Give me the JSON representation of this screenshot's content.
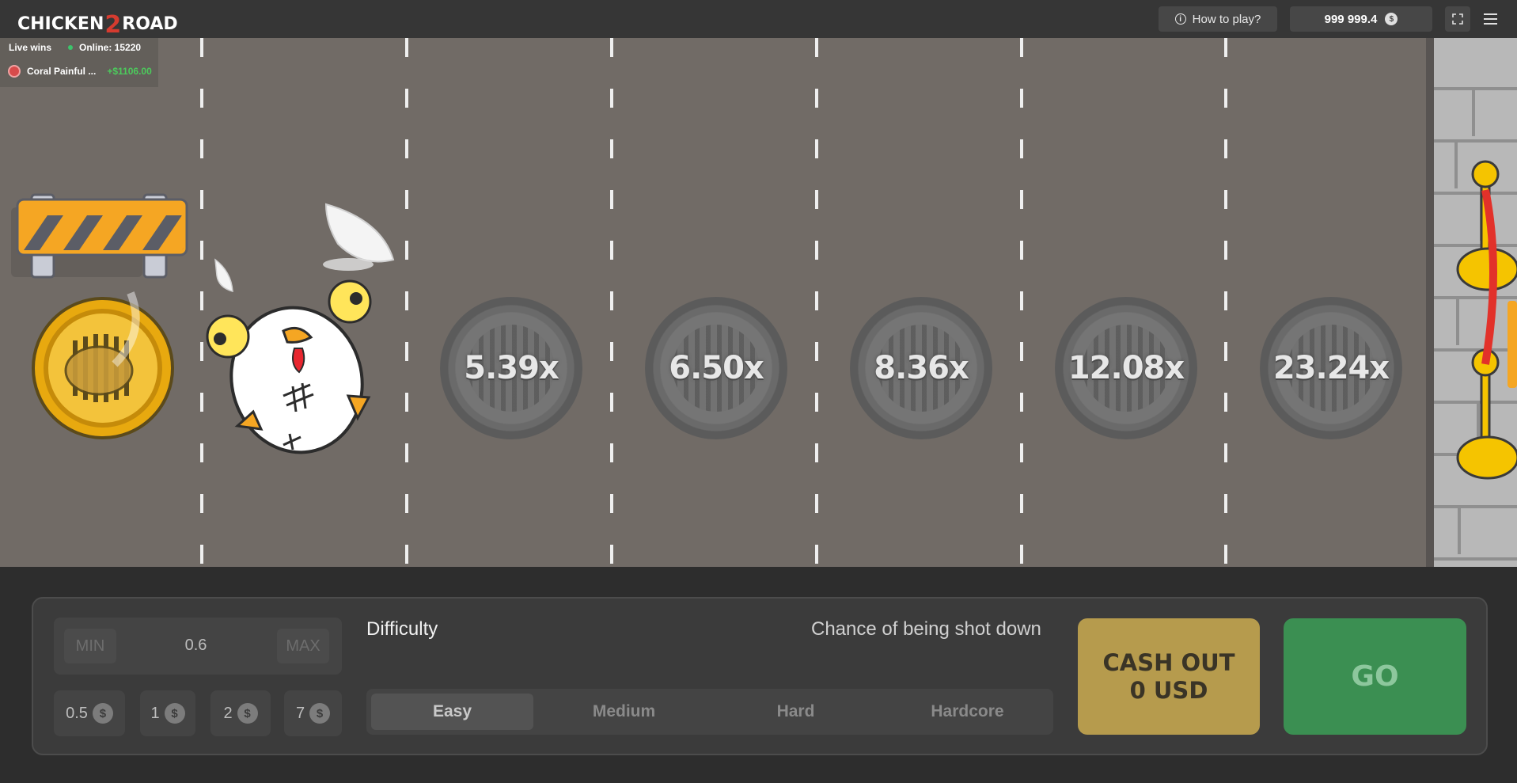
{
  "header": {
    "logo_left": "CHICKEN",
    "logo_mid": "2",
    "logo_right": "ROAD",
    "howto_label": "How to play?",
    "balance": "999 999.4",
    "currency_symbol": "$"
  },
  "live": {
    "label": "Live wins",
    "online": "Online: 15220",
    "winner_name": "Coral Painful ...",
    "winner_amount": "+$1106.00"
  },
  "multipliers": [
    "5.39x",
    "6.50x",
    "8.36x",
    "12.08x",
    "23.24x"
  ],
  "bet": {
    "min_label": "MIN",
    "max_label": "MAX",
    "value": "0.6",
    "chips": [
      "0.5",
      "1",
      "2",
      "7"
    ],
    "chip_symbol": "$"
  },
  "difficulty": {
    "label": "Difficulty",
    "chance_label": "Chance of being shot down",
    "options": [
      "Easy",
      "Medium",
      "Hard",
      "Hardcore"
    ],
    "selected": "Easy"
  },
  "actions": {
    "cashout_line1": "CASH OUT",
    "cashout_line2": "0 USD",
    "go_label": "GO"
  },
  "colors": {
    "road": "#716b66",
    "cashout": "#b69b4d",
    "go": "#3b8f52",
    "win_green": "#4ccb5c"
  }
}
